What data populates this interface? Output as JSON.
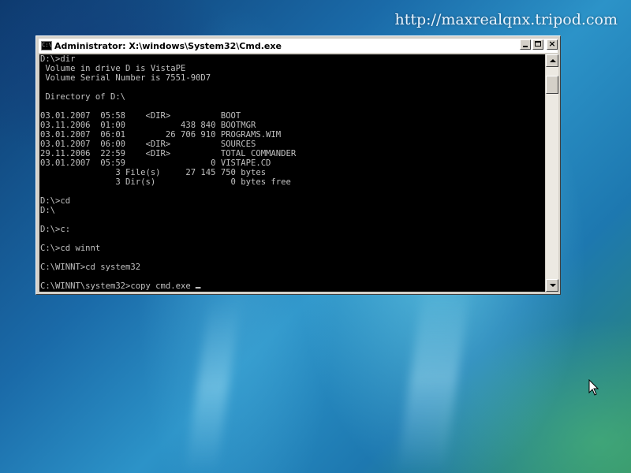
{
  "desktop": {
    "watermark": "http://maxrealqnx.tripod.com"
  },
  "window": {
    "title": "Administrator: X:\\windows\\System32\\Cmd.exe",
    "icon": "cmd-icon",
    "icon_glyph": "C:\\"
  },
  "console": {
    "lines": [
      "D:\\>dir",
      " Volume in drive D is VistaPE",
      " Volume Serial Number is 7551-90D7",
      "",
      " Directory of D:\\",
      "",
      "03.01.2007  05:58    <DIR>          BOOT",
      "03.11.2006  01:00           438 840 BOOTMGR",
      "03.01.2007  06:01        26 706 910 PROGRAMS.WIM",
      "03.01.2007  06:00    <DIR>          SOURCES",
      "29.11.2006  22:59    <DIR>          TOTAL COMMANDER",
      "03.01.2007  05:59                 0 VISTAPE.CD",
      "               3 File(s)     27 145 750 bytes",
      "               3 Dir(s)               0 bytes free",
      "",
      "D:\\>cd",
      "D:\\",
      "",
      "D:\\>c:",
      "",
      "C:\\>cd winnt",
      "",
      "C:\\WINNT>cd system32",
      ""
    ],
    "prompt": "C:\\WINNT\\system32>copy cmd.exe "
  },
  "colors": {
    "console_bg": "#000000",
    "console_fg": "#c0c0c0",
    "window_frame": "#d4d0c8"
  }
}
